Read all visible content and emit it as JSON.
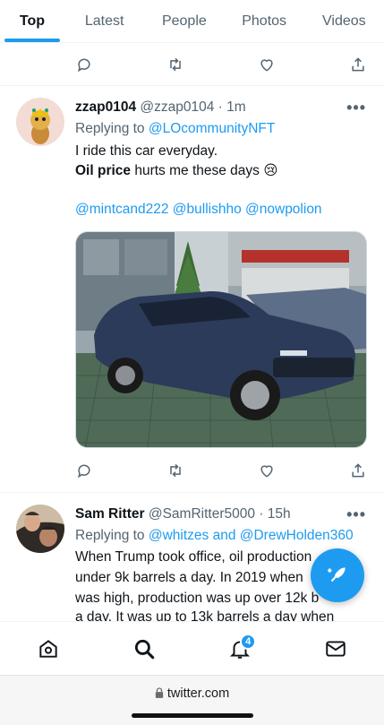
{
  "tabs": [
    {
      "label": "Top",
      "active": true
    },
    {
      "label": "Latest",
      "active": false
    },
    {
      "label": "People",
      "active": false
    },
    {
      "label": "Photos",
      "active": false
    },
    {
      "label": "Videos",
      "active": false
    }
  ],
  "tweets": [
    {
      "name": "zzap0104",
      "handle": "@zzap0104",
      "time": "· 1m",
      "replying_prefix": "Replying to",
      "replying_to": "@LOcommunityNFT",
      "lines": [
        "I ride this car everyday."
      ],
      "bold_phrase": "Oil price",
      "line2_rest": " hurts me these days",
      "emoji": "😢",
      "mentions": "@mintcand222 @bullishho @nowpolion",
      "has_photo": true
    },
    {
      "name": "Sam Ritter",
      "handle": "@SamRitter5000",
      "time": "· 15h",
      "replying_prefix": "Replying to",
      "replying_to": "@whitzes and @DrewHolden360",
      "lines": [
        "When Trump took office, oil production",
        "under 9k barrels a day. In 2019 when",
        "was high, production was up over 12k b",
        "a day. It was up to 13k barrels a day when"
      ]
    }
  ],
  "more_glyph": "•••",
  "nav": {
    "notifications_badge": "4",
    "icons": [
      "home-icon",
      "search-icon",
      "bell-icon",
      "mail-icon"
    ]
  },
  "browser": {
    "url": "twitter.com"
  },
  "colors": {
    "accent": "#1d9bf0",
    "text": "#0f1419",
    "secondary": "#536471"
  }
}
